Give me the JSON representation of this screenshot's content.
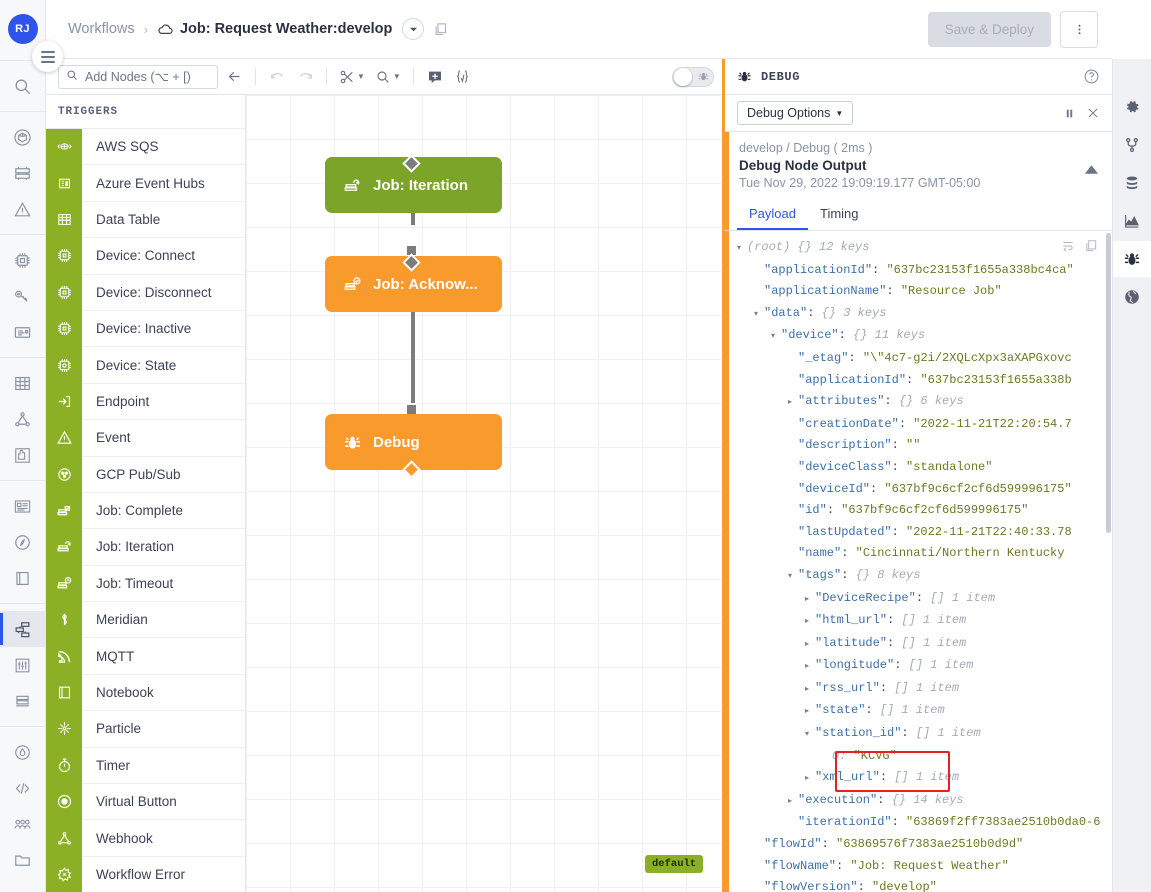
{
  "user": {
    "initials": "RJ"
  },
  "left_rail": {
    "groups": [
      {
        "items": [
          {
            "name": "search-icon",
            "label": "Search"
          }
        ]
      },
      {
        "items": [
          {
            "name": "applications-icon",
            "label": "Applications"
          },
          {
            "name": "dashboards-icon",
            "label": "Dashboards"
          },
          {
            "name": "events-icon",
            "label": "Events"
          }
        ]
      },
      {
        "items": [
          {
            "name": "devices-icon",
            "label": "Devices"
          },
          {
            "name": "device-recipes-icon",
            "label": "Device Recipes"
          },
          {
            "name": "device-logs-icon",
            "label": "Device Logs"
          }
        ]
      },
      {
        "items": [
          {
            "name": "data-tables-icon",
            "label": "Data Tables"
          },
          {
            "name": "webhooks-icon",
            "label": "Webhooks"
          },
          {
            "name": "integrations-icon",
            "label": "Integrations"
          }
        ]
      },
      {
        "items": [
          {
            "name": "notebooks-icon",
            "label": "Notebooks"
          },
          {
            "name": "experience-icon",
            "label": "Experience"
          },
          {
            "name": "files-icon",
            "label": "Files"
          }
        ]
      },
      {
        "items": [
          {
            "name": "workflows-icon",
            "label": "Workflows",
            "active": true
          },
          {
            "name": "settings-sliders-icon",
            "label": "Workflow Settings"
          },
          {
            "name": "workflow-storage-icon",
            "label": "Workflow Storage"
          }
        ]
      },
      {
        "items": [
          {
            "name": "access-keys-icon",
            "label": "Access Keys"
          },
          {
            "name": "api-tokens-icon",
            "label": "API Tokens"
          },
          {
            "name": "members-icon",
            "label": "Members"
          },
          {
            "name": "folders-icon",
            "label": "Folders"
          }
        ]
      }
    ]
  },
  "topbar": {
    "breadcrumb_root": "Workflows",
    "breadcrumb_sep": "›",
    "breadcrumb_title": "Job: Request Weather:develop",
    "version_caret_icon": "chevron-down-icon",
    "copy_icon": "copy-icon",
    "cloud_icon": "cloud-icon",
    "save_deploy_label": "Save & Deploy",
    "kebab_icon": "more-vertical-icon"
  },
  "toolbar": {
    "search_placeholder": "Add Nodes (⌥ + [)",
    "search_value": "",
    "search_icon": "search-icon",
    "back_icon": "arrow-left-icon",
    "undo_icon": "undo-icon",
    "redo_icon": "redo-icon",
    "cut_icon": "scissors-icon",
    "zoom_icon": "zoom-icon",
    "add_note_icon": "add-note-icon",
    "template_icon": "template-braces-icon",
    "debug_toggle_icon": "bug-icon",
    "debug_toggle_on": false
  },
  "triggers": {
    "header": "TRIGGERS",
    "items": [
      {
        "label": "AWS SQS",
        "icon": "aws-sqs-icon"
      },
      {
        "label": "Azure Event Hubs",
        "icon": "azure-event-hubs-icon"
      },
      {
        "label": "Data Table",
        "icon": "data-table-icon"
      },
      {
        "label": "Device: Connect",
        "icon": "device-connect-icon"
      },
      {
        "label": "Device: Disconnect",
        "icon": "device-disconnect-icon"
      },
      {
        "label": "Device: Inactive",
        "icon": "device-inactive-icon"
      },
      {
        "label": "Device: State",
        "icon": "device-state-icon"
      },
      {
        "label": "Endpoint",
        "icon": "endpoint-icon"
      },
      {
        "label": "Event",
        "icon": "event-icon"
      },
      {
        "label": "GCP Pub/Sub",
        "icon": "gcp-pubsub-icon"
      },
      {
        "label": "Job: Complete",
        "icon": "job-complete-icon"
      },
      {
        "label": "Job: Iteration",
        "icon": "job-iteration-icon"
      },
      {
        "label": "Job: Timeout",
        "icon": "job-timeout-icon"
      },
      {
        "label": "Meridian",
        "icon": "meridian-icon"
      },
      {
        "label": "MQTT",
        "icon": "mqtt-icon"
      },
      {
        "label": "Notebook",
        "icon": "notebook-icon"
      },
      {
        "label": "Particle",
        "icon": "particle-icon"
      },
      {
        "label": "Timer",
        "icon": "timer-icon"
      },
      {
        "label": "Virtual Button",
        "icon": "virtual-button-icon"
      },
      {
        "label": "Webhook",
        "icon": "webhook-icon"
      },
      {
        "label": "Workflow Error",
        "icon": "workflow-error-icon"
      }
    ]
  },
  "canvas": {
    "nodes": [
      {
        "label": "Job: Iteration",
        "color": "#7ba428",
        "icon": "job-iteration-icon"
      },
      {
        "label": "Job: Acknow...",
        "color": "#f99a2c",
        "icon": "job-acknowledge-icon"
      },
      {
        "label": "Debug",
        "color": "#f99a2c",
        "icon": "bug-icon"
      }
    ],
    "default_badge": "default"
  },
  "debug": {
    "title": "DEBUG",
    "title_icon": "bug-icon",
    "help_icon": "help-circle-icon",
    "options_label": "Debug Options",
    "options_caret": "caret-down-icon",
    "pause_icon": "pause-icon",
    "close_icon": "close-icon",
    "entry_path": "develop / Debug ( 2ms )",
    "entry_name": "Debug Node Output",
    "entry_timestamp": "Tue Nov 29, 2022 19:09:19.177 GMT-05:00",
    "collapse_icon": "chevron-up-icon",
    "tabs": [
      {
        "label": "Payload",
        "active": true
      },
      {
        "label": "Timing",
        "active": false
      }
    ],
    "wrap_icon": "wrap-text-icon",
    "copy_icon": "copy-icon",
    "json_rows": [
      {
        "indent": 0,
        "tri": "▾",
        "root": "(root)",
        "meta": "{}  12 keys"
      },
      {
        "indent": 1,
        "key": "\"applicationId\"",
        "val": "\"637bc23153f1655a338bc4ca\""
      },
      {
        "indent": 1,
        "key": "\"applicationName\"",
        "val": "\"Resource Job\""
      },
      {
        "indent": 1,
        "tri": "▾",
        "key": "\"data\"",
        "meta": "{}  3 keys"
      },
      {
        "indent": 2,
        "tri": "▾",
        "key": "\"device\"",
        "meta": "{}  11 keys"
      },
      {
        "indent": 3,
        "key": "\"_etag\"",
        "val": "\"\\\"4c7-g2i/2XQLcXpx3aXAPGxovc"
      },
      {
        "indent": 3,
        "key": "\"applicationId\"",
        "val": "\"637bc23153f1655a338b"
      },
      {
        "indent": 3,
        "tri": "▸",
        "key": "\"attributes\"",
        "meta": "{}  6 keys"
      },
      {
        "indent": 3,
        "key": "\"creationDate\"",
        "val": "\"2022-11-21T22:20:54.7"
      },
      {
        "indent": 3,
        "key": "\"description\"",
        "val": "\"\""
      },
      {
        "indent": 3,
        "key": "\"deviceClass\"",
        "val": "\"standalone\""
      },
      {
        "indent": 3,
        "key": "\"deviceId\"",
        "val": "\"637bf9c6cf2cf6d599996175\""
      },
      {
        "indent": 3,
        "key": "\"id\"",
        "val": "\"637bf9c6cf2cf6d599996175\""
      },
      {
        "indent": 3,
        "key": "\"lastUpdated\"",
        "val": "\"2022-11-21T22:40:33.78"
      },
      {
        "indent": 3,
        "key": "\"name\"",
        "val": "\"Cincinnati/Northern Kentucky "
      },
      {
        "indent": 3,
        "tri": "▾",
        "key": "\"tags\"",
        "meta": "{}  8 keys"
      },
      {
        "indent": 4,
        "tri": "▸",
        "key": "\"DeviceRecipe\"",
        "meta": "[]  1 item"
      },
      {
        "indent": 4,
        "tri": "▸",
        "key": "\"html_url\"",
        "meta": "[]  1 item"
      },
      {
        "indent": 4,
        "tri": "▸",
        "key": "\"latitude\"",
        "meta": "[]  1 item"
      },
      {
        "indent": 4,
        "tri": "▸",
        "key": "\"longitude\"",
        "meta": "[]  1 item"
      },
      {
        "indent": 4,
        "tri": "▸",
        "key": "\"rss_url\"",
        "meta": "[]  1 item"
      },
      {
        "indent": 4,
        "tri": "▸",
        "key": "\"state\"",
        "meta": "[]  1 item"
      },
      {
        "indent": 4,
        "tri": "▾",
        "key": "\"station_id\"",
        "meta": "[]  1 item",
        "highlight": true
      },
      {
        "indent": 5,
        "key": "0:",
        "val": "\"KCVG\"",
        "plainkey": true
      },
      {
        "indent": 4,
        "tri": "▸",
        "key": "\"xml_url\"",
        "meta": "[]  1 item"
      },
      {
        "indent": 3,
        "tri": "▸",
        "key": "\"execution\"",
        "meta": "{}  14 keys"
      },
      {
        "indent": 3,
        "key": "\"iterationId\"",
        "val": "\"63869f2ff7383ae2510b0da0-6"
      },
      {
        "indent": 1,
        "key": "\"flowId\"",
        "val": "\"63869576f7383ae2510b0d9d\""
      },
      {
        "indent": 1,
        "key": "\"flowName\"",
        "val": "\"Job: Request Weather\""
      },
      {
        "indent": 1,
        "key": "\"flowVersion\"",
        "val": "\"develop\""
      }
    ]
  },
  "right_rail": {
    "items": [
      {
        "name": "gear-icon",
        "label": "Settings"
      },
      {
        "name": "branch-icon",
        "label": "Versions"
      },
      {
        "name": "storage-icon",
        "label": "Storage"
      },
      {
        "name": "chart-icon",
        "label": "Stats"
      },
      {
        "name": "bug-icon",
        "label": "Debug",
        "active": true
      },
      {
        "name": "globe-icon",
        "label": "Globals"
      }
    ]
  }
}
